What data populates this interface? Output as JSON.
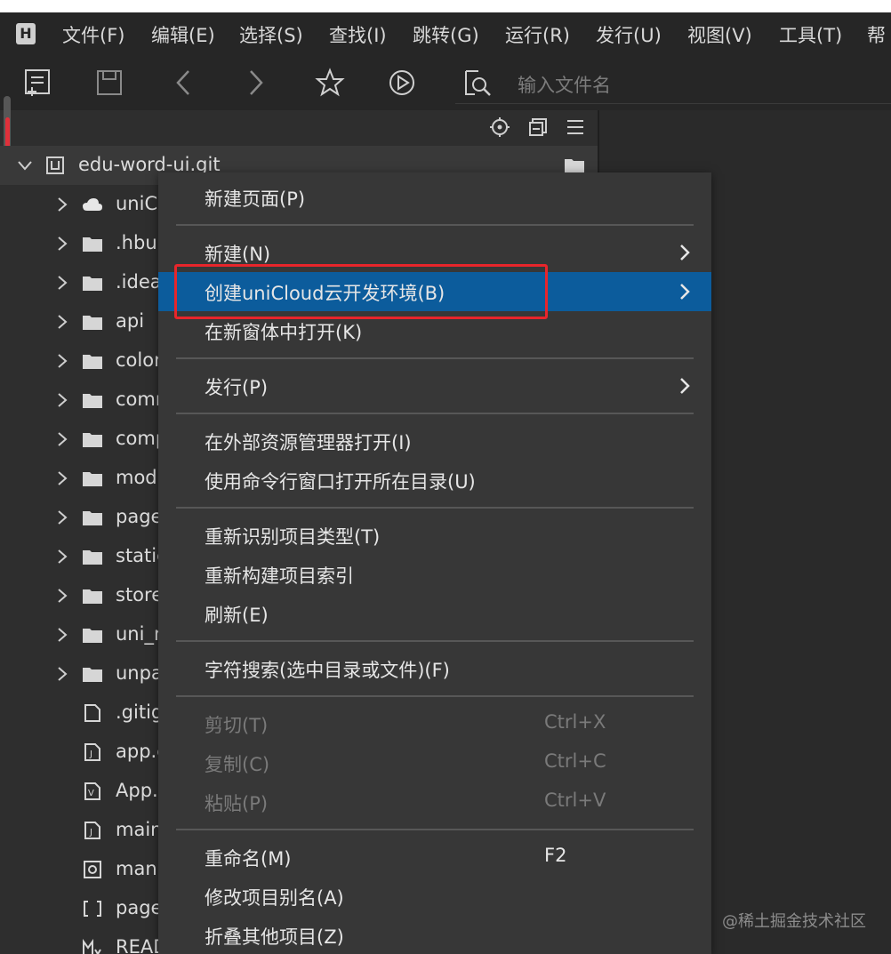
{
  "menubar": {
    "logo": "H",
    "items": [
      "文件(F)",
      "编辑(E)",
      "选择(S)",
      "查找(I)",
      "跳转(G)",
      "运行(R)",
      "发行(U)",
      "视图(V)",
      "工具(T)",
      "帮"
    ]
  },
  "toolbar": {
    "search_placeholder": "输入文件名",
    "icons": [
      "new-file-icon",
      "save-icon",
      "back-icon",
      "forward-icon",
      "star-icon",
      "run-icon",
      "file-search-icon"
    ]
  },
  "panel_head_icons": [
    "locate-icon",
    "collapse-icon",
    "menu-icon"
  ],
  "tree": {
    "root": "edu-word-ui.git",
    "items": [
      {
        "label": "uniC",
        "icon": "cloud-folder-icon",
        "folder": true
      },
      {
        "label": ".hbu",
        "icon": "folder-icon",
        "folder": true
      },
      {
        "label": ".idea",
        "icon": "folder-icon",
        "folder": true
      },
      {
        "label": "api",
        "icon": "folder-icon",
        "folder": true
      },
      {
        "label": "color",
        "icon": "folder-icon",
        "folder": true
      },
      {
        "label": "comm",
        "icon": "folder-icon",
        "folder": true
      },
      {
        "label": "comp",
        "icon": "folder-icon",
        "folder": true
      },
      {
        "label": "mod",
        "icon": "folder-icon",
        "folder": true
      },
      {
        "label": "page",
        "icon": "folder-icon",
        "folder": true
      },
      {
        "label": "static",
        "icon": "folder-icon",
        "folder": true
      },
      {
        "label": "store",
        "icon": "folder-icon",
        "folder": true
      },
      {
        "label": "uni_r",
        "icon": "folder-icon",
        "folder": true
      },
      {
        "label": "unpa",
        "icon": "folder-icon",
        "folder": true
      },
      {
        "label": ".gitig",
        "icon": "file-icon",
        "folder": false
      },
      {
        "label": "app.c",
        "icon": "js-file-icon",
        "folder": false
      },
      {
        "label": "App.",
        "icon": "vue-file-icon",
        "folder": false
      },
      {
        "label": "main",
        "icon": "js-file-icon",
        "folder": false
      },
      {
        "label": "man",
        "icon": "settings-file-icon",
        "folder": false
      },
      {
        "label": "page",
        "icon": "json-file-icon",
        "folder": false
      },
      {
        "label": "READ",
        "icon": "markdown-file-icon",
        "folder": false
      }
    ]
  },
  "context_menu": {
    "items": [
      {
        "label": "新建页面(P)",
        "shortcut": "",
        "submenu": false,
        "disabled": false,
        "highlight": false
      },
      {
        "label": "新建(N)",
        "shortcut": "",
        "submenu": true,
        "disabled": false,
        "highlight": false
      },
      {
        "label": "创建uniCloud云开发环境(B)",
        "shortcut": "",
        "submenu": true,
        "disabled": false,
        "highlight": true
      },
      {
        "label": "在新窗体中打开(K)",
        "shortcut": "",
        "submenu": false,
        "disabled": false,
        "highlight": false
      },
      {
        "label": "发行(P)",
        "shortcut": "",
        "submenu": true,
        "disabled": false,
        "highlight": false
      },
      {
        "label": "在外部资源管理器打开(I)",
        "shortcut": "",
        "submenu": false,
        "disabled": false,
        "highlight": false
      },
      {
        "label": "使用命令行窗口打开所在目录(U)",
        "shortcut": "",
        "submenu": false,
        "disabled": false,
        "highlight": false
      },
      {
        "label": "重新识别项目类型(T)",
        "shortcut": "",
        "submenu": false,
        "disabled": false,
        "highlight": false
      },
      {
        "label": "重新构建项目索引",
        "shortcut": "",
        "submenu": false,
        "disabled": false,
        "highlight": false
      },
      {
        "label": "刷新(E)",
        "shortcut": "",
        "submenu": false,
        "disabled": false,
        "highlight": false
      },
      {
        "label": "字符搜索(选中目录或文件)(F)",
        "shortcut": "",
        "submenu": false,
        "disabled": false,
        "highlight": false
      },
      {
        "label": "剪切(T)",
        "shortcut": "Ctrl+X",
        "submenu": false,
        "disabled": true,
        "highlight": false
      },
      {
        "label": "复制(C)",
        "shortcut": "Ctrl+C",
        "submenu": false,
        "disabled": true,
        "highlight": false
      },
      {
        "label": "粘贴(P)",
        "shortcut": "Ctrl+V",
        "submenu": false,
        "disabled": true,
        "highlight": false
      },
      {
        "label": "重命名(M)",
        "shortcut": "F2",
        "submenu": false,
        "disabled": false,
        "highlight": false
      },
      {
        "label": "修改项目别名(A)",
        "shortcut": "",
        "submenu": false,
        "disabled": false,
        "highlight": false
      },
      {
        "label": "折叠其他项目(Z)",
        "shortcut": "",
        "submenu": false,
        "disabled": false,
        "highlight": false
      }
    ]
  },
  "watermark": "@稀土掘金技术社区",
  "colors": {
    "highlight": "#0c5c9c",
    "annotation_red": "#e8252b",
    "background": "#2b2b2b"
  }
}
